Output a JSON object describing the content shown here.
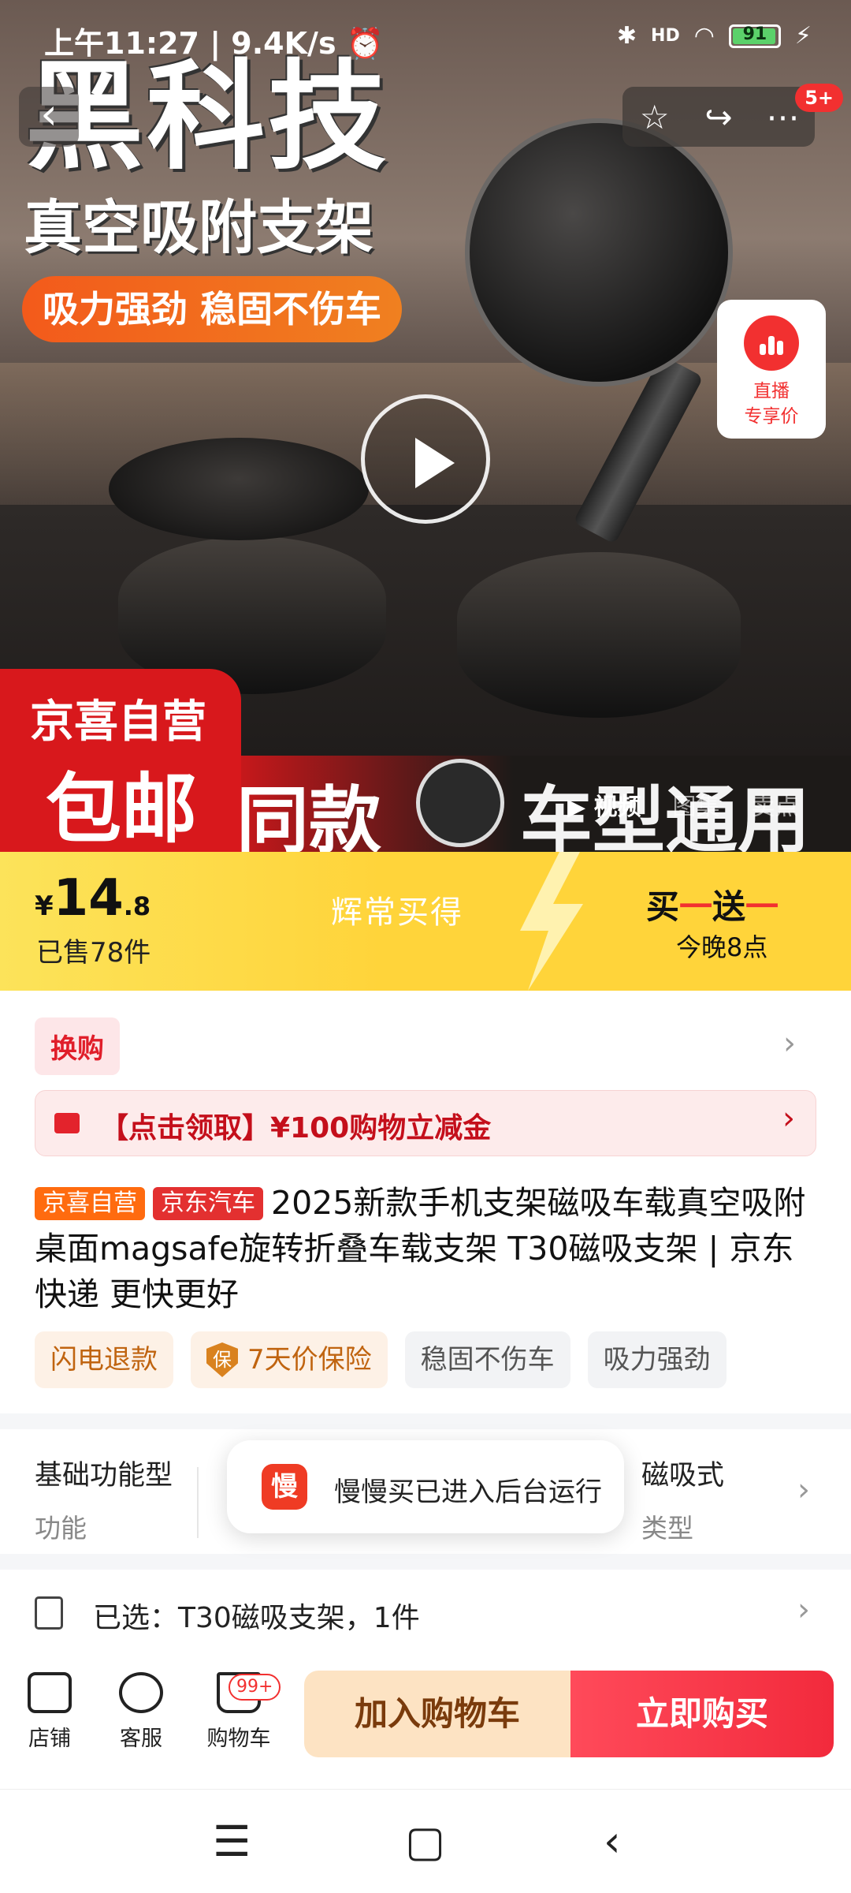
{
  "status_bar": {
    "time": "上午11:27 | 9.4K/s ⏰",
    "signal_hd": "HD",
    "battery": "91"
  },
  "hero": {
    "headline": "黑科技",
    "subhead": "真空吸附支架",
    "tagline": "吸力强劲 稳固不伤车",
    "promo_corner_top": "京喜自营",
    "promo_corner_main": "包邮",
    "banner_left": "同款",
    "banner_right": "车型通用",
    "live_badge_line1": "直播",
    "live_badge_line2": "专享价",
    "share_count_badge": "5+",
    "media_tabs": [
      "▶ 视频",
      "图集",
      "卖点"
    ]
  },
  "price_strip": {
    "currency": "¥",
    "price_int": "14",
    "price_dec": ".8",
    "sold": "已售78件",
    "slogan": "辉常买得",
    "deal_title_a": "买",
    "deal_title_b": "一",
    "deal_title_c": "送",
    "deal_title_d": "一",
    "deal_sub": "今晚8点"
  },
  "swap": {
    "label": "换购"
  },
  "coupon": {
    "text": "【点击领取】¥100购物立减金"
  },
  "product": {
    "tag_1": "京喜自营",
    "tag_2": "京东汽车",
    "title": "2025新款手机支架磁吸车载真空吸附桌面magsafe旋转折叠车载支架 T30磁吸支架 | 京东快递 更快更好"
  },
  "features": [
    "闪电退款",
    "7天价保险",
    "稳固不伤车",
    "吸力强劲"
  ],
  "features_shield": "保",
  "specs": [
    {
      "value": "基础功能型",
      "key": "功能"
    },
    {
      "value": "磁吸式",
      "key": "类型"
    }
  ],
  "toast": {
    "icon_text": "慢",
    "text": "慢慢买已进入后台运行"
  },
  "selected": {
    "text": "已选：T30磁吸支架，1件"
  },
  "bottom_bar": {
    "store": "店铺",
    "service": "客服",
    "cart": "购物车",
    "cart_badge": "99+",
    "add_to_cart": "加入购物车",
    "buy_now": "立即购买"
  },
  "colors": {
    "accent_red": "#f23030",
    "price_yellow": "#ffd43a",
    "cart_btn": "#fde3c3"
  }
}
